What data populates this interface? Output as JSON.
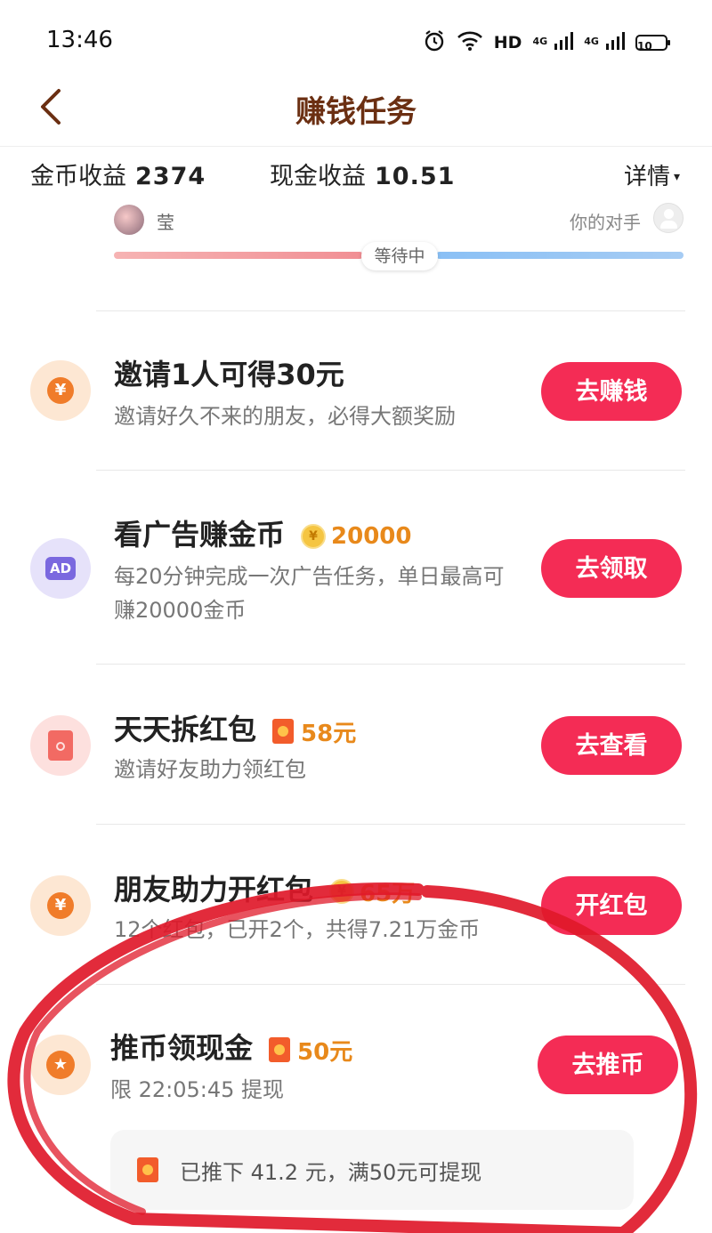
{
  "status_bar": {
    "time": "13:46",
    "hd_label": "HD",
    "net1": "4G",
    "net2": "4G",
    "battery_level": "10"
  },
  "header": {
    "title": "赚钱任务"
  },
  "earnings": {
    "coin_label": "金币收益",
    "coin_value": "2374",
    "cash_label": "现金收益",
    "cash_value": "10.51",
    "details_label": "详情"
  },
  "pk": {
    "user_name": "莹",
    "opponent_label": "你的对手",
    "status": "等待中"
  },
  "tasks": [
    {
      "title": "邀请1人可得30元",
      "reward": "",
      "desc": "邀请好久不来的朋友，必得大额奖励",
      "button": "去赚钱",
      "icon": "yen-icon"
    },
    {
      "title": "看广告赚金币",
      "reward": "20000",
      "desc": "每20分钟完成一次广告任务，单日最高可赚20000金币",
      "button": "去领取",
      "icon": "ad-icon"
    },
    {
      "title": "天天拆红包",
      "reward": "58元",
      "desc": "邀请好友助力领红包",
      "button": "去查看",
      "icon": "red-envelope-icon"
    },
    {
      "title": "朋友助力开红包",
      "reward": "65万",
      "desc": "12个红包，已开2个，共得7.21万金币",
      "button": "开红包",
      "icon": "yen-icon"
    },
    {
      "title": "推币领现金",
      "reward": "50元",
      "desc": "限 22:05:45 提现",
      "button": "去推币",
      "icon": "star-icon"
    }
  ],
  "withdraw_note": "已推下 41.2 元，满50元可提现",
  "icons": {
    "coin_symbol": "¥",
    "star_symbol": "★",
    "ad_text": "AD"
  },
  "colors": {
    "accent": "#f42c55",
    "title_brown": "#6b2f12",
    "reward_orange": "#e8891b",
    "annotation_red": "#e0192a"
  }
}
